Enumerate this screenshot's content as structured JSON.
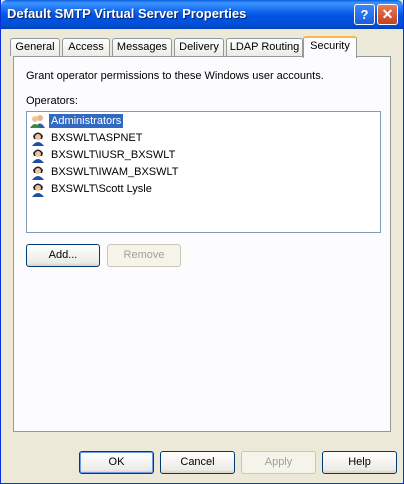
{
  "window": {
    "title": "Default SMTP Virtual Server Properties",
    "help_glyph": "?",
    "close_glyph": "✕"
  },
  "tabs": [
    {
      "label": "General"
    },
    {
      "label": "Access"
    },
    {
      "label": "Messages"
    },
    {
      "label": "Delivery"
    },
    {
      "label": "LDAP Routing"
    },
    {
      "label": "Security",
      "active": true
    }
  ],
  "security": {
    "description": "Grant operator permissions to these Windows user accounts.",
    "operators_label": "Operators:",
    "operators": [
      {
        "name": "Administrators",
        "icon": "group-icon",
        "selected": true
      },
      {
        "name": "BXSWLT\\ASPNET",
        "icon": "user-icon"
      },
      {
        "name": "BXSWLT\\IUSR_BXSWLT",
        "icon": "user-icon"
      },
      {
        "name": "BXSWLT\\IWAM_BXSWLT",
        "icon": "user-icon"
      },
      {
        "name": "BXSWLT\\Scott Lysle",
        "icon": "user-icon"
      }
    ],
    "add_label": "Add...",
    "remove_label": "Remove"
  },
  "footer": {
    "ok": "OK",
    "cancel": "Cancel",
    "apply": "Apply",
    "help": "Help"
  }
}
